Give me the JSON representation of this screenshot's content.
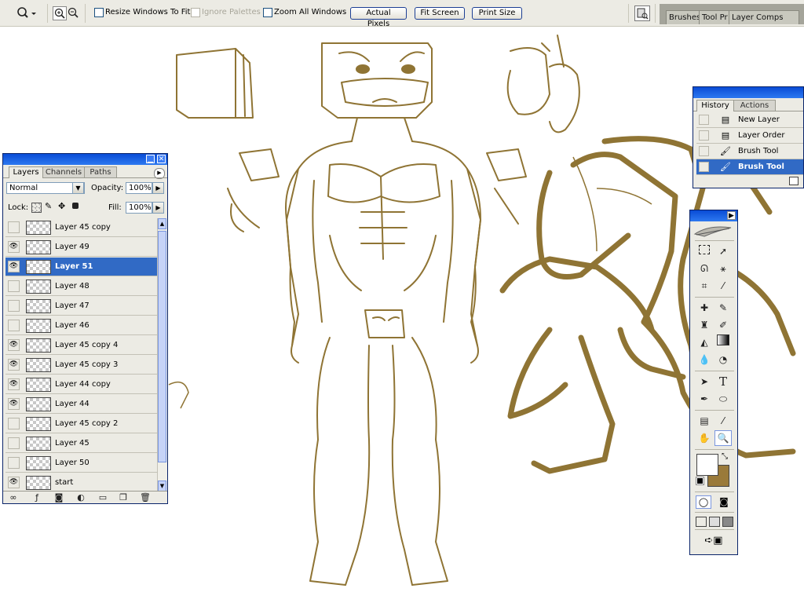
{
  "options_bar": {
    "tool_icon": "zoom-tool-icon",
    "zoom_in_icon": "zoom-in-icon",
    "zoom_out_icon": "zoom-out-icon",
    "resize_windows_label": "Resize Windows To Fit",
    "ignore_palettes_label": "Ignore Palettes",
    "zoom_all_windows_label": "Zoom All Windows",
    "actual_pixels_label": "Actual Pixels",
    "fit_screen_label": "Fit Screen",
    "print_size_label": "Print Size",
    "well_tabs": [
      "Brushes",
      "Tool Pr",
      "Layer Comps"
    ]
  },
  "layers_panel": {
    "tabs": [
      "Layers",
      "Channels",
      "Paths"
    ],
    "blend_mode": "Normal",
    "opacity_label": "Opacity:",
    "opacity_value": "100%",
    "lock_label": "Lock:",
    "fill_label": "Fill:",
    "fill_value": "100%",
    "layers": [
      {
        "name": "Layer 45 copy",
        "visible": false,
        "selected": false
      },
      {
        "name": "Layer 49",
        "visible": true,
        "selected": false
      },
      {
        "name": "Layer 51",
        "visible": true,
        "selected": true
      },
      {
        "name": "Layer 48",
        "visible": false,
        "selected": false
      },
      {
        "name": "Layer 47",
        "visible": false,
        "selected": false
      },
      {
        "name": "Layer 46",
        "visible": false,
        "selected": false
      },
      {
        "name": "Layer 45 copy 4",
        "visible": true,
        "selected": false
      },
      {
        "name": "Layer 45 copy 3",
        "visible": true,
        "selected": false
      },
      {
        "name": "Layer 44 copy",
        "visible": true,
        "selected": false
      },
      {
        "name": "Layer 44",
        "visible": true,
        "selected": false
      },
      {
        "name": "Layer 45 copy 2",
        "visible": false,
        "selected": false
      },
      {
        "name": "Layer 45",
        "visible": false,
        "selected": false
      },
      {
        "name": "Layer 50",
        "visible": false,
        "selected": false
      },
      {
        "name": "start",
        "visible": true,
        "selected": false
      }
    ]
  },
  "history_panel": {
    "tabs": [
      "History",
      "Actions"
    ],
    "items": [
      {
        "name": "New Layer",
        "icon": "document-icon",
        "selected": false
      },
      {
        "name": "Layer Order",
        "icon": "document-icon",
        "selected": false
      },
      {
        "name": "Brush Tool",
        "icon": "brush-icon",
        "selected": false
      },
      {
        "name": "Brush Tool",
        "icon": "brush-icon",
        "selected": true
      }
    ]
  },
  "colors": {
    "foreground": "#ffffff",
    "background": "#9a7a3a",
    "sketch_stroke": "#8f7434",
    "selection": "#316ac5",
    "titlebar": "#0a4cd6"
  }
}
